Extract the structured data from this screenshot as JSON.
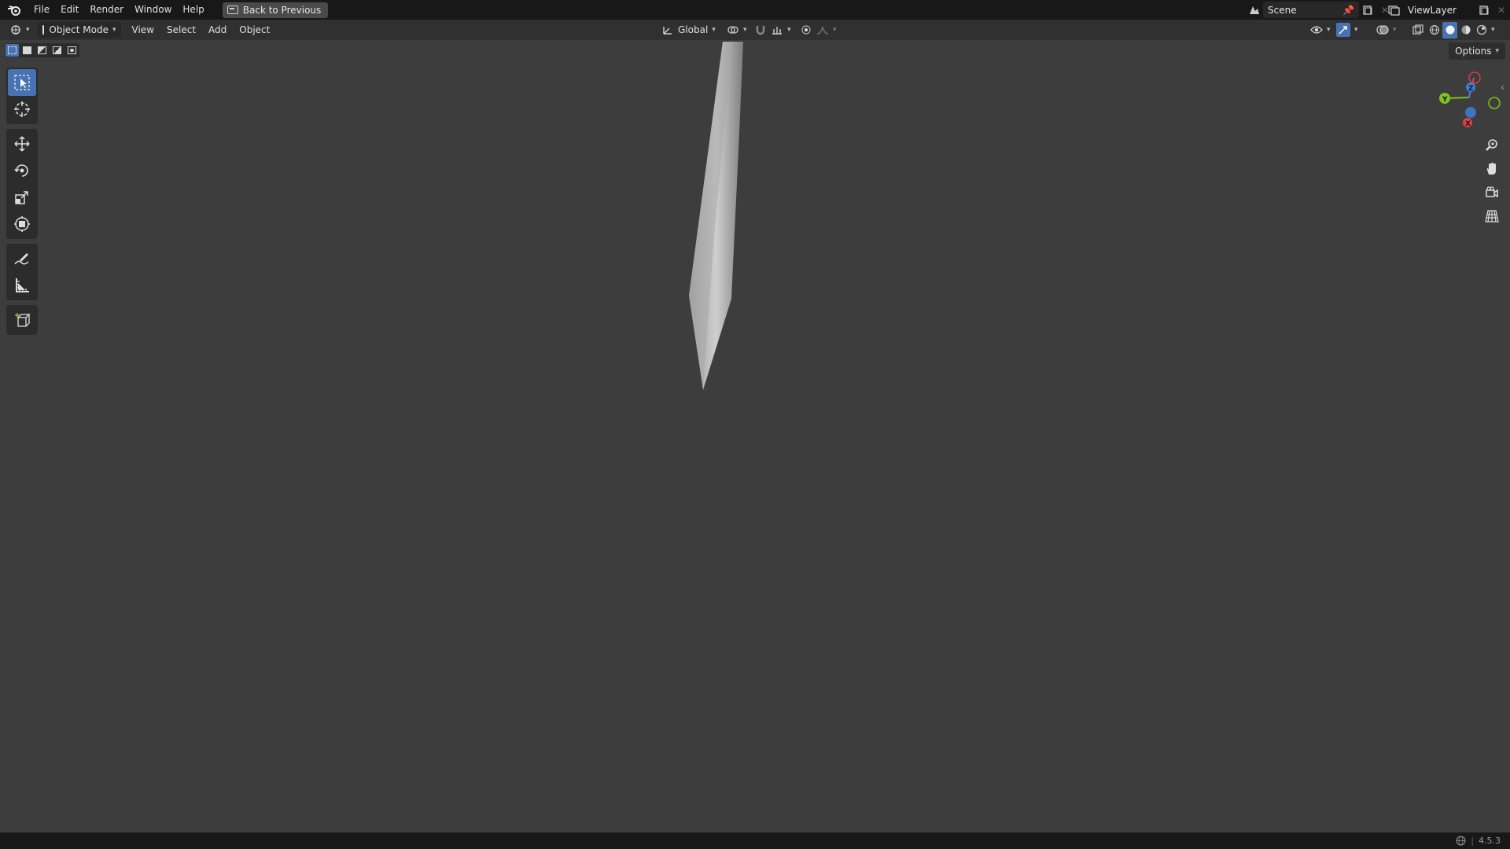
{
  "menu": {
    "items": [
      "File",
      "Edit",
      "Render",
      "Window",
      "Help"
    ],
    "back_button": "Back to Previous"
  },
  "scene": {
    "name": "Scene"
  },
  "view_layer": {
    "name": "ViewLayer"
  },
  "header": {
    "mode": "Object Mode",
    "menus": [
      "View",
      "Select",
      "Add",
      "Object"
    ],
    "transform_orientation": "Global"
  },
  "options": {
    "label": "Options"
  },
  "gizmo": {
    "axes": [
      "X",
      "Y",
      "Z"
    ],
    "colors": {
      "x": "#e0404a",
      "y": "#80c020",
      "z": "#3d7fd6"
    }
  },
  "status": {
    "version": "4.5.3"
  },
  "colors": {
    "accent": "#4772b3",
    "viewport": "#3d3d3d",
    "topbar": "#181818",
    "header": "#303030"
  }
}
